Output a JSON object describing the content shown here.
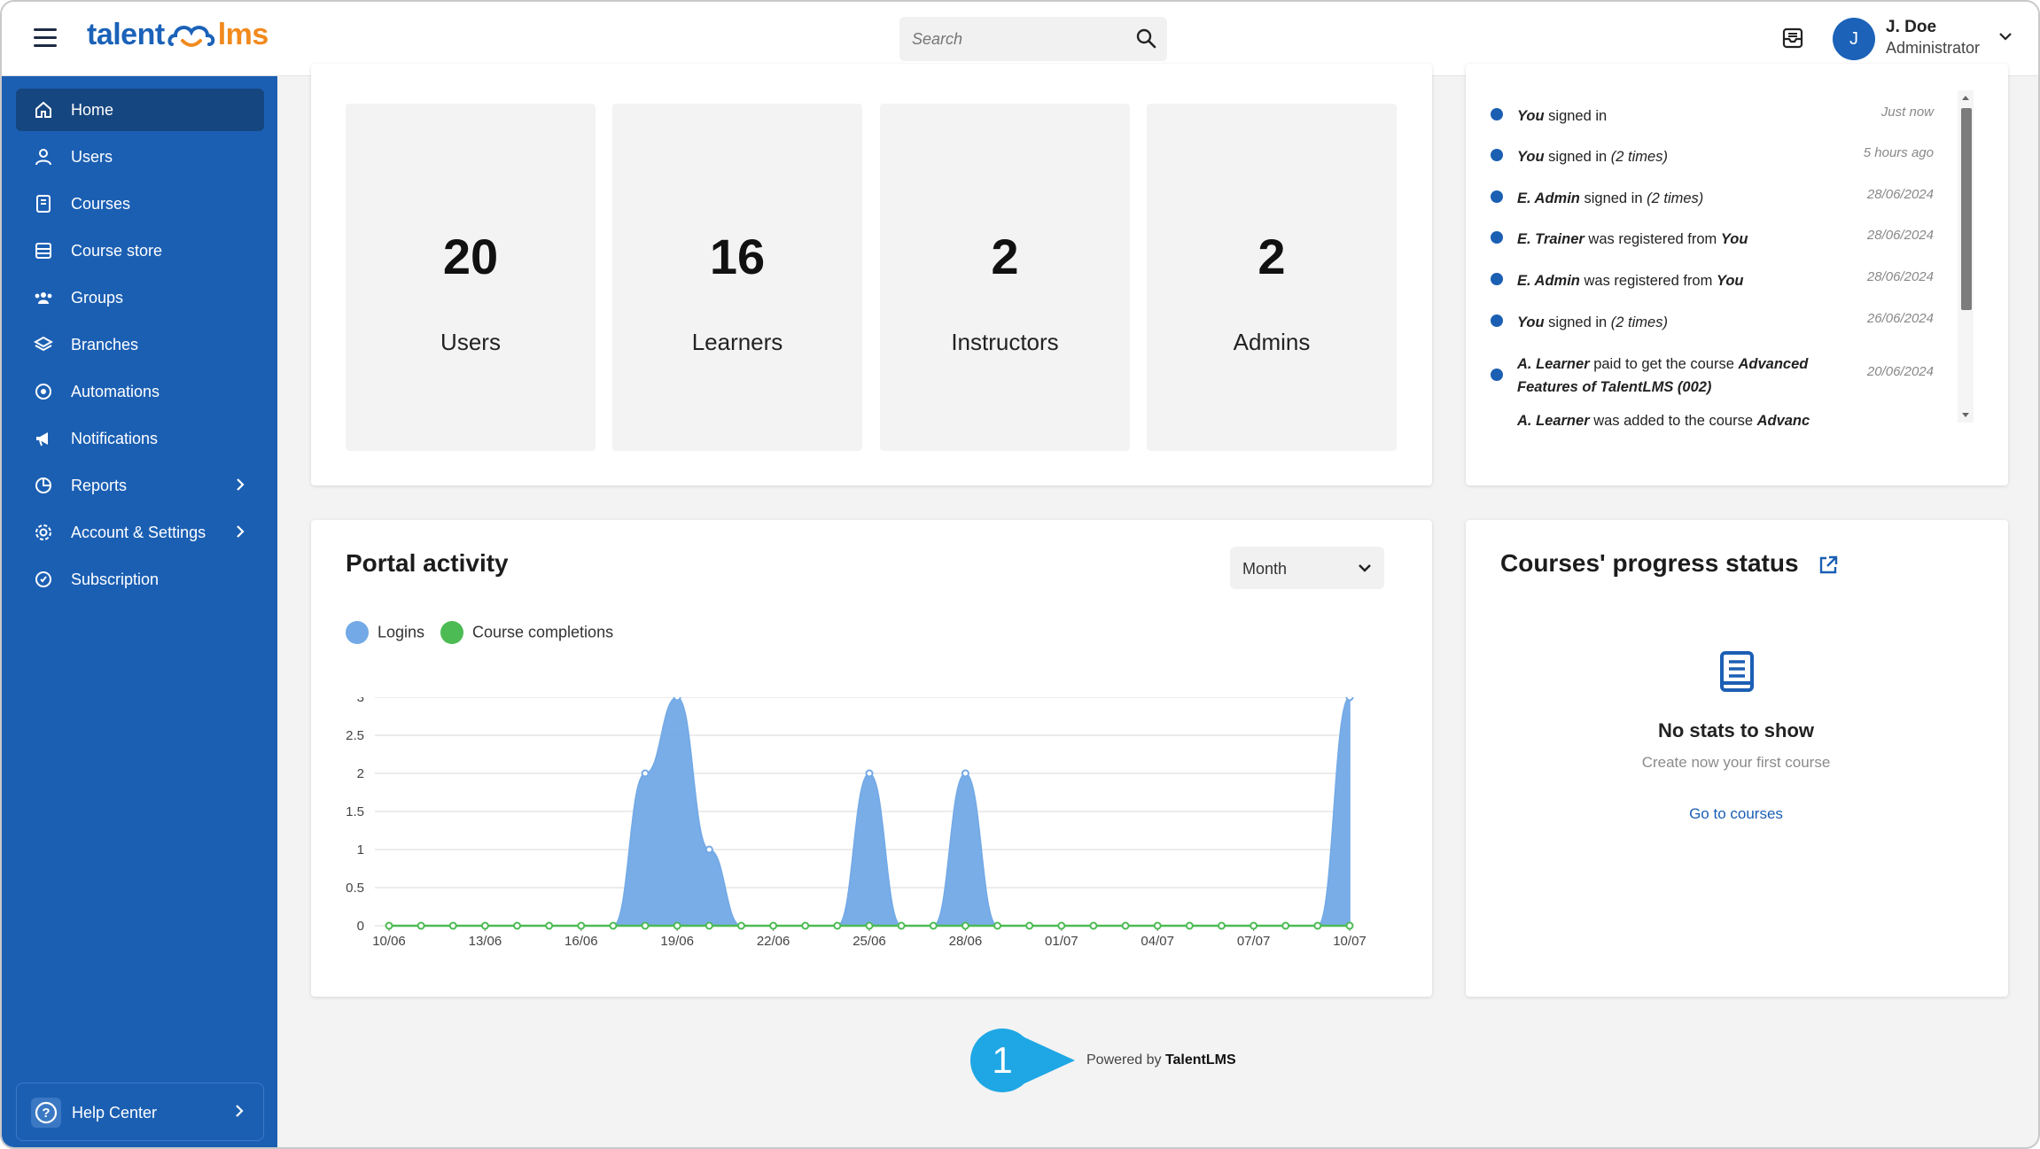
{
  "header": {
    "logo_left": "talent",
    "logo_right": "lms",
    "search_placeholder": "Search",
    "user": {
      "initial": "J",
      "name": "J. Doe",
      "role": "Administrator"
    }
  },
  "sidebar": {
    "items": [
      {
        "label": "Home",
        "icon": "home-icon",
        "active": true
      },
      {
        "label": "Users",
        "icon": "user-icon"
      },
      {
        "label": "Courses",
        "icon": "book-icon"
      },
      {
        "label": "Course store",
        "icon": "store-icon"
      },
      {
        "label": "Groups",
        "icon": "groups-icon"
      },
      {
        "label": "Branches",
        "icon": "layers-icon"
      },
      {
        "label": "Automations",
        "icon": "automation-icon"
      },
      {
        "label": "Notifications",
        "icon": "megaphone-icon"
      },
      {
        "label": "Reports",
        "icon": "pie-chart-icon",
        "has_children": true
      },
      {
        "label": "Account & Settings",
        "icon": "gear-icon",
        "has_children": true
      },
      {
        "label": "Subscription",
        "icon": "subscription-icon"
      }
    ],
    "help": "Help Center"
  },
  "stats": [
    {
      "value": "20",
      "label": "Users"
    },
    {
      "value": "16",
      "label": "Learners"
    },
    {
      "value": "2",
      "label": "Instructors"
    },
    {
      "value": "2",
      "label": "Admins"
    }
  ],
  "timeline": [
    {
      "actor": "You",
      "action": " signed in",
      "extra": "",
      "when": "Just now"
    },
    {
      "actor": "You",
      "action": " signed in ",
      "extra": "(2 times)",
      "when": "5 hours ago"
    },
    {
      "actor": "E. Admin",
      "action": " signed in ",
      "extra": "(2 times)",
      "when": "28/06/2024"
    },
    {
      "actor": "E. Trainer",
      "action": " was registered from ",
      "extra": "You",
      "when": "28/06/2024"
    },
    {
      "actor": "E. Admin",
      "action": " was registered from ",
      "extra": "You",
      "when": "28/06/2024"
    },
    {
      "actor": "You",
      "action": " signed in ",
      "extra": "(2 times)",
      "when": "26/06/2024"
    },
    {
      "actor": "A. Learner",
      "action": " paid to get the course ",
      "extra": "Advanced Features of TalentLMS (002)",
      "when": "20/06/2024"
    },
    {
      "actor": "A. Learner",
      "action": " was added to the course ",
      "extra": "Advanc",
      "when": ""
    }
  ],
  "portal_activity": {
    "title": "Portal activity",
    "period": "Month",
    "legend": [
      {
        "name": "Logins",
        "color": "#72a9e6"
      },
      {
        "name": "Course completions",
        "color": "#4cbb54"
      }
    ]
  },
  "chart_data": {
    "type": "area",
    "title": "Portal activity",
    "x": [
      "10/06",
      "11/06",
      "12/06",
      "13/06",
      "14/06",
      "15/06",
      "16/06",
      "17/06",
      "18/06",
      "19/06",
      "20/06",
      "21/06",
      "22/06",
      "23/06",
      "24/06",
      "25/06",
      "26/06",
      "27/06",
      "28/06",
      "29/06",
      "30/06",
      "01/07",
      "02/07",
      "03/07",
      "04/07",
      "05/07",
      "06/07",
      "07/07",
      "08/07",
      "09/07",
      "10/07"
    ],
    "tick_labels": [
      "10/06",
      "13/06",
      "16/06",
      "19/06",
      "22/06",
      "25/06",
      "28/06",
      "01/07",
      "04/07",
      "07/07",
      "10/07"
    ],
    "y_ticks": [
      "0",
      "0.5",
      "1",
      "1.5",
      "2",
      "2.5",
      "3"
    ],
    "ylim": [
      0,
      3
    ],
    "grid": true,
    "series": [
      {
        "name": "Logins",
        "color": "#72a9e6",
        "values": [
          0,
          0,
          0,
          0,
          0,
          0,
          0,
          0,
          2,
          3,
          1,
          0,
          0,
          0,
          0,
          2,
          0,
          0,
          2,
          0,
          0,
          0,
          0,
          0,
          0,
          0,
          0,
          0,
          0,
          0,
          3
        ]
      },
      {
        "name": "Course completions",
        "color": "#4cbb54",
        "values": [
          0,
          0,
          0,
          0,
          0,
          0,
          0,
          0,
          0,
          0,
          0,
          0,
          0,
          0,
          0,
          0,
          0,
          0,
          0,
          0,
          0,
          0,
          0,
          0,
          0,
          0,
          0,
          0,
          0,
          0,
          0
        ]
      }
    ]
  },
  "courses_progress": {
    "title": "Courses' progress status",
    "empty_title": "No stats to show",
    "empty_sub": "Create now your first course",
    "link": "Go to courses"
  },
  "footer": {
    "badge": "1",
    "powered_prefix": "Powered by ",
    "powered_brand": "TalentLMS"
  }
}
